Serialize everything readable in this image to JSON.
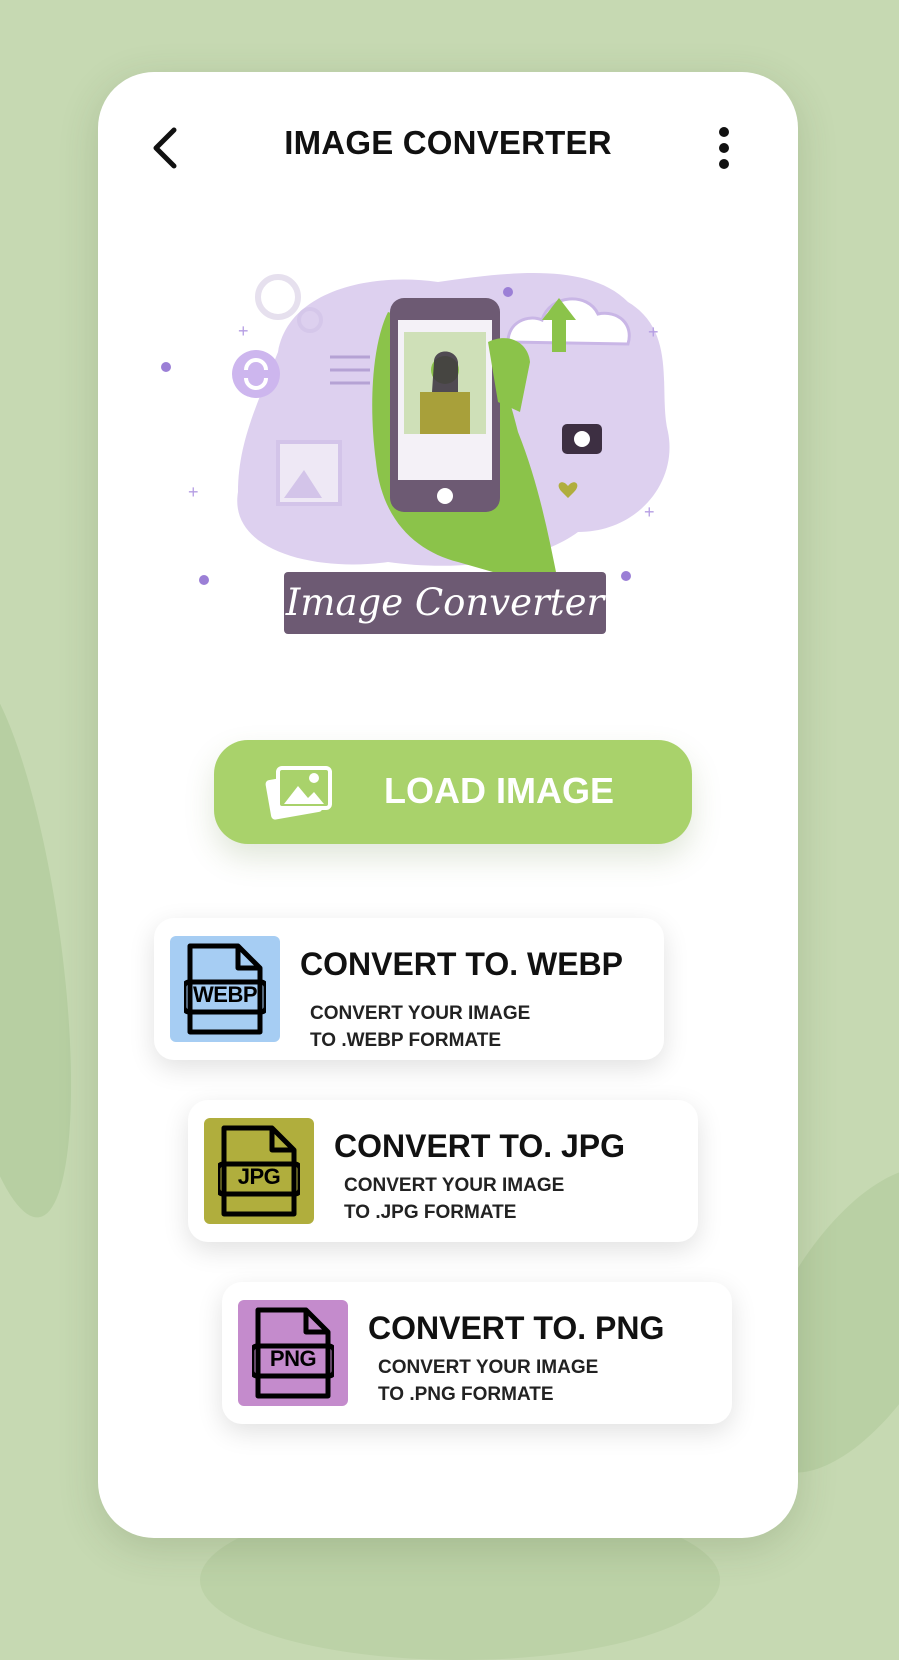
{
  "header": {
    "title": "IMAGE CONVERTER",
    "back_icon": "chevron-left-icon",
    "menu_icon": "more-vertical-icon"
  },
  "illustration": {
    "banner_text": "Image Converter"
  },
  "load_button": {
    "label": "LOAD IMAGE",
    "icon": "images-icon"
  },
  "options": [
    {
      "badge": "WEBP",
      "title": "CONVERT TO. WEBP",
      "desc_line1": "CONVERT YOUR IMAGE",
      "desc_line2": "TO .WEBP FORMATE",
      "badge_color": "#a6cdf3"
    },
    {
      "badge": "JPG",
      "title": "CONVERT TO. JPG",
      "desc_line1": "CONVERT YOUR IMAGE",
      "desc_line2": "TO .JPG FORMATE",
      "badge_color": "#b0ae3d"
    },
    {
      "badge": "PNG",
      "title": "CONVERT TO. PNG",
      "desc_line1": "CONVERT YOUR IMAGE",
      "desc_line2": "TO .PNG  FORMATE",
      "badge_color": "#c48bcc"
    }
  ],
  "colors": {
    "background": "#c6d9b2",
    "accent_green": "#a9d26b",
    "banner_purple": "#6d5a73",
    "illustration_lavender": "#ddd0ef"
  }
}
